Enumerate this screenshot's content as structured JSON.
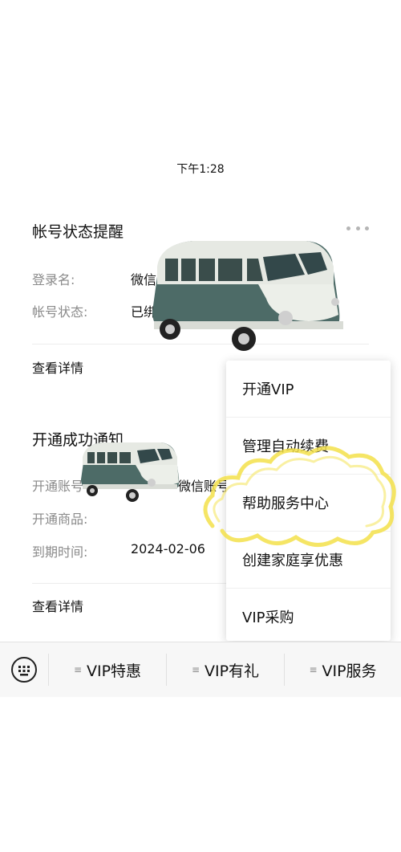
{
  "status_bar": {
    "time": "下午1:28"
  },
  "card1": {
    "title": "帐号状态提醒",
    "rows": [
      {
        "label": "登录名:",
        "value": "微信"
      },
      {
        "label": "帐号状态:",
        "value": "已绑"
      }
    ],
    "detail_link": "查看详情"
  },
  "card2": {
    "title": "开通成功通知",
    "rows": [
      {
        "label": "开通账号",
        "value": "微信账号"
      },
      {
        "label": "开通商品:",
        "value": ""
      },
      {
        "label": "到期时间:",
        "value": "2024-02-06"
      }
    ],
    "detail_link": "查看详情"
  },
  "popup_menu": {
    "items": [
      "开通VIP",
      "管理自动续费",
      "帮助服务中心",
      "创建家庭享优惠",
      "VIP采购"
    ]
  },
  "bottom_bar": {
    "keyboard_icon": "keyboard-icon",
    "tabs": [
      {
        "icon": "menu-icon",
        "label": "VIP特惠"
      },
      {
        "icon": "menu-icon",
        "label": "VIP有礼"
      },
      {
        "icon": "menu-icon",
        "label": "VIP服务"
      }
    ]
  },
  "colors": {
    "bus_body": "#4d6b67",
    "bus_roof": "#e9ece6",
    "scribble": "#f3e04a"
  }
}
